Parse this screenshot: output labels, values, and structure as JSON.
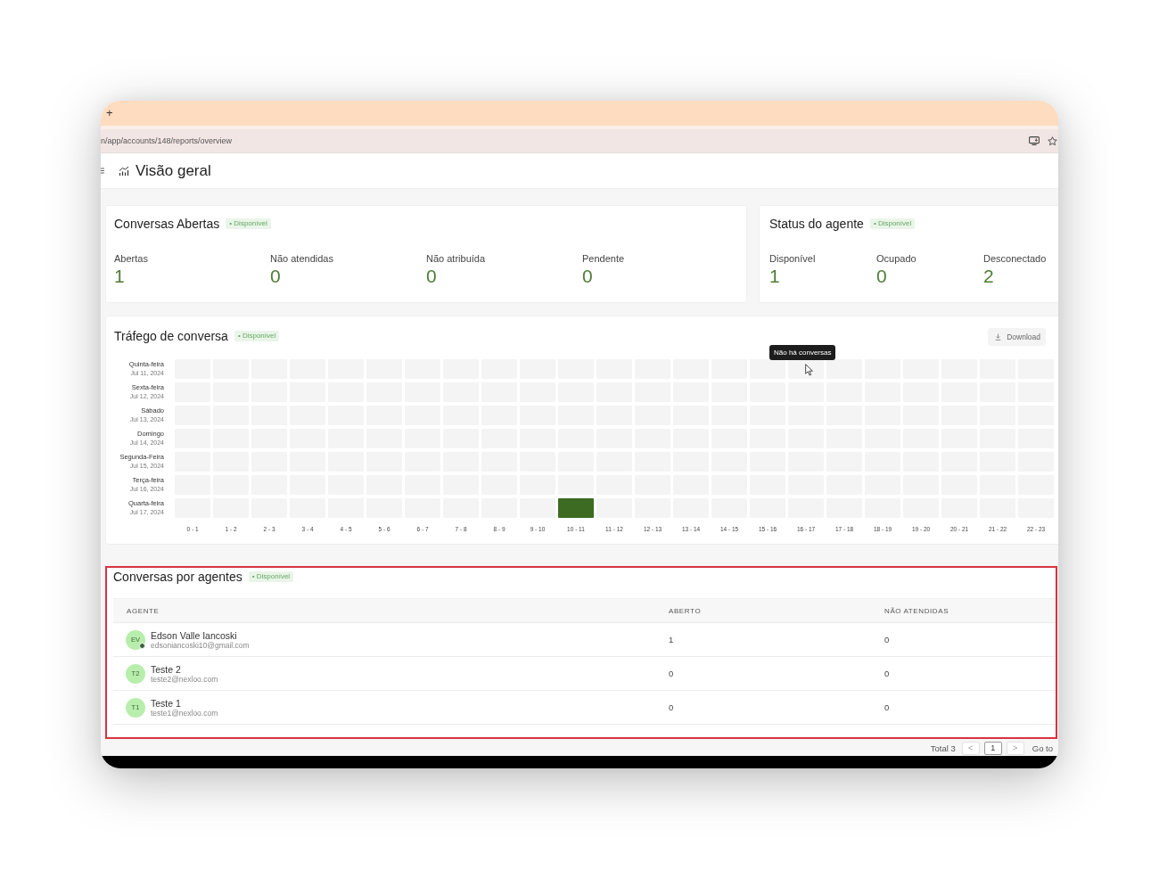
{
  "browser": {
    "new_tab": "+",
    "url": "n/app/accounts/148/reports/overview"
  },
  "header": {
    "title": "Visão geral"
  },
  "open_conversations": {
    "title": "Conversas Abertas",
    "badge": "• Disponível",
    "metrics": [
      {
        "label": "Abertas",
        "value": "1"
      },
      {
        "label": "Não atendidas",
        "value": "0"
      },
      {
        "label": "Não atribuída",
        "value": "0"
      },
      {
        "label": "Pendente",
        "value": "0"
      }
    ]
  },
  "agent_status": {
    "title": "Status do agente",
    "badge": "• Disponível",
    "metrics": [
      {
        "label": "Disponível",
        "value": "1"
      },
      {
        "label": "Ocupado",
        "value": "0"
      },
      {
        "label": "Desconectado",
        "value": "2"
      }
    ]
  },
  "traffic": {
    "title": "Tráfego de conversa",
    "badge": "• Disponível",
    "download_button": "Download",
    "tooltip": "Não há conversas",
    "hours": [
      "0 - 1",
      "1 - 2",
      "2 - 3",
      "3 - 4",
      "4 - 5",
      "5 - 6",
      "6 - 7",
      "7 - 8",
      "8 - 9",
      "9 - 10",
      "10 - 11",
      "11 - 12",
      "12 - 13",
      "13 - 14",
      "14 - 15",
      "15 - 16",
      "16 - 17",
      "17 - 18",
      "18 - 19",
      "19 - 20",
      "20 - 21",
      "21 - 22",
      "22 - 23"
    ],
    "days": [
      {
        "day": "Quinta-feira",
        "date": "Jul 11, 2024",
        "filled": [
          false,
          false,
          false,
          false,
          false,
          false,
          false,
          false,
          false,
          false,
          false,
          false,
          false,
          false,
          false,
          false,
          false,
          false,
          false,
          false,
          false,
          false,
          false
        ]
      },
      {
        "day": "Sexta-feira",
        "date": "Jul 12, 2024",
        "filled": [
          false,
          false,
          false,
          false,
          false,
          false,
          false,
          false,
          false,
          false,
          false,
          false,
          false,
          false,
          false,
          false,
          false,
          false,
          false,
          false,
          false,
          false,
          false
        ]
      },
      {
        "day": "Sábado",
        "date": "Jul 13, 2024",
        "filled": [
          false,
          false,
          false,
          false,
          false,
          false,
          false,
          false,
          false,
          false,
          false,
          false,
          false,
          false,
          false,
          false,
          false,
          false,
          false,
          false,
          false,
          false,
          false
        ]
      },
      {
        "day": "Domingo",
        "date": "Jul 14, 2024",
        "filled": [
          false,
          false,
          false,
          false,
          false,
          false,
          false,
          false,
          false,
          false,
          false,
          false,
          false,
          false,
          false,
          false,
          false,
          false,
          false,
          false,
          false,
          false,
          false
        ]
      },
      {
        "day": "Segunda-Feira",
        "date": "Jul 15, 2024",
        "filled": [
          false,
          false,
          false,
          false,
          false,
          false,
          false,
          false,
          false,
          false,
          false,
          false,
          false,
          false,
          false,
          false,
          false,
          false,
          false,
          false,
          false,
          false,
          false
        ]
      },
      {
        "day": "Terça-feira",
        "date": "Jul 16, 2024",
        "filled": [
          false,
          false,
          false,
          false,
          false,
          false,
          false,
          false,
          false,
          false,
          false,
          false,
          false,
          false,
          false,
          false,
          false,
          false,
          false,
          false,
          false,
          false,
          false
        ]
      },
      {
        "day": "Quarta-feira",
        "date": "Jul 17, 2024",
        "filled": [
          false,
          false,
          false,
          false,
          false,
          false,
          false,
          false,
          false,
          false,
          true,
          false,
          false,
          false,
          false,
          false,
          false,
          false,
          false,
          false,
          false,
          false,
          false
        ]
      }
    ]
  },
  "agents_table": {
    "title": "Conversas por agentes",
    "badge": "• Disponível",
    "columns": [
      "AGENTE",
      "ABERTO",
      "NÃO ATENDIDAS"
    ],
    "rows": [
      {
        "initials": "EV",
        "name": "Edson Valle Iancoski",
        "email": "edsoniancoski10@gmail.com",
        "online": true,
        "open": "1",
        "unattended": "0"
      },
      {
        "initials": "T2",
        "name": "Teste 2",
        "email": "teste2@nexloo.com",
        "online": false,
        "open": "0",
        "unattended": "0"
      },
      {
        "initials": "T1",
        "name": "Teste 1",
        "email": "teste1@nexloo.com",
        "online": false,
        "open": "0",
        "unattended": "0"
      }
    ]
  },
  "pagination": {
    "total": "Total 3",
    "previous": "<",
    "pages": [
      {
        "label": "1",
        "selected": true
      }
    ],
    "next": ">",
    "go_to": "Go to"
  }
}
